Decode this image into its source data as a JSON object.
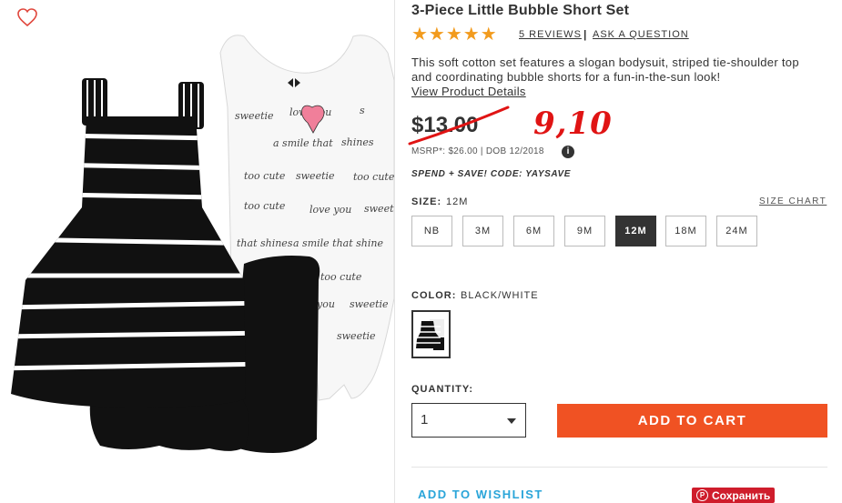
{
  "product": {
    "title": "3-Piece Little Bubble Short Set",
    "rating_stars": "★★★★★",
    "rating": 5,
    "reviews_label": "5 REVIEWS",
    "ask_label": "ASK A QUESTION",
    "description": "This soft cotton set features a slogan bodysuit, striped tie-shoulder top and coordinating bubble shorts for a fun-in-the-sun look!",
    "details_link": "View Product Details"
  },
  "pricing": {
    "price": "$13.00",
    "new_price": "9,10",
    "msrp": "MSRP*: $26.00 | DOB 12/2018",
    "info_glyph": "i",
    "promo": "SPEND + SAVE! CODE: YAYSAVE"
  },
  "size": {
    "label": "SIZE:",
    "selected": "12M",
    "chart_link": "SIZE CHART",
    "options": [
      "NB",
      "3M",
      "6M",
      "9M",
      "12M",
      "18M",
      "24M"
    ]
  },
  "color": {
    "label": "COLOR:",
    "selected": "BLACK/WHITE"
  },
  "quantity": {
    "label": "QUANTITY:",
    "value": "1"
  },
  "actions": {
    "add_to_cart": "ADD TO CART",
    "wishlist": "ADD TO WISHLIST",
    "pin_label": "Сохранить",
    "pin_glyph": "P"
  },
  "colors": {
    "stars": "#f29b1d",
    "cart_button": "#f05223",
    "wishlist_link": "#2aa5d9",
    "annotation_red": "#e01414",
    "favorite_icon": "#e0463c",
    "pin_button": "#cf1d2c"
  }
}
